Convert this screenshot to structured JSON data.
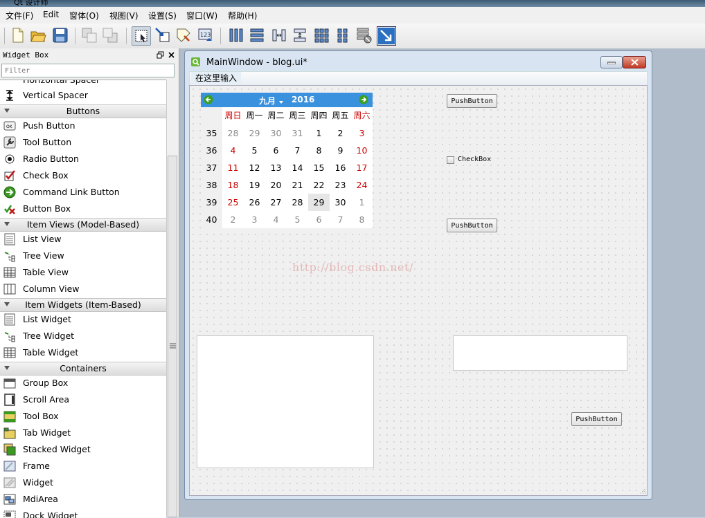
{
  "app": {
    "title": "Qt 设计师"
  },
  "menubar": [
    "文件(F)",
    "Edit",
    "窗体(O)",
    "视图(V)",
    "设置(S)",
    "窗口(W)",
    "帮助(H)"
  ],
  "toolbar": {
    "icons": [
      "new-file-icon",
      "open-file-icon",
      "save-icon",
      "send-to-back-icon",
      "bring-to-front-icon",
      "edit-widgets-icon",
      "edit-signals-slots-icon",
      "edit-buddies-icon",
      "edit-tab-order-icon",
      "layout-horizontal-icon",
      "layout-vertical-icon",
      "layout-horizontal-splitter-icon",
      "layout-vertical-splitter-icon",
      "layout-form-icon",
      "layout-grid-icon",
      "break-layout-icon",
      "adjust-size-icon"
    ]
  },
  "widget_box": {
    "title": "Widget Box",
    "filter_placeholder": "Filter",
    "partial_item": "Horizontal Spacer",
    "first_item": "Vertical Spacer",
    "categories": [
      {
        "name": "Buttons",
        "items": [
          "Push Button",
          "Tool Button",
          "Radio Button",
          "Check Box",
          "Command Link Button",
          "Button Box"
        ]
      },
      {
        "name": "Item Views (Model-Based)",
        "items": [
          "List View",
          "Tree View",
          "Table View",
          "Column View"
        ]
      },
      {
        "name": "Item Widgets (Item-Based)",
        "items": [
          "List Widget",
          "Tree Widget",
          "Table Widget"
        ]
      },
      {
        "name": "Containers",
        "items": [
          "Group Box",
          "Scroll Area",
          "Tool Box",
          "Tab Widget",
          "Stacked Widget",
          "Frame",
          "Widget",
          "MdiArea",
          "Dock Widget"
        ]
      }
    ]
  },
  "form": {
    "title": "MainWindow - blog.ui*",
    "menu_placeholder": "在这里输入",
    "push_button_1": "PushButton",
    "push_button_2": "PushButton",
    "push_button_3": "PushButton",
    "checkbox": "CheckBox",
    "watermark": "http://blog.csdn.net/"
  },
  "calendar": {
    "month": "九月",
    "year": "2016",
    "days_of_week": [
      "周日",
      "周一",
      "周二",
      "周三",
      "周四",
      "周五",
      "周六"
    ],
    "weeks": [
      {
        "week": "35",
        "days": [
          "28",
          "29",
          "30",
          "31",
          "1",
          "2",
          "3"
        ]
      },
      {
        "week": "36",
        "days": [
          "4",
          "5",
          "6",
          "7",
          "8",
          "9",
          "10"
        ]
      },
      {
        "week": "37",
        "days": [
          "11",
          "12",
          "13",
          "14",
          "15",
          "16",
          "17"
        ]
      },
      {
        "week": "38",
        "days": [
          "18",
          "19",
          "20",
          "21",
          "22",
          "23",
          "24"
        ]
      },
      {
        "week": "39",
        "days": [
          "25",
          "26",
          "27",
          "28",
          "29",
          "30",
          "1"
        ]
      },
      {
        "week": "40",
        "days": [
          "2",
          "3",
          "4",
          "5",
          "6",
          "7",
          "8"
        ]
      }
    ],
    "selected_day": "29"
  },
  "colors": {
    "calendar_header": "#3a91de",
    "weekend": "#cc0000",
    "muted": "#888888"
  }
}
